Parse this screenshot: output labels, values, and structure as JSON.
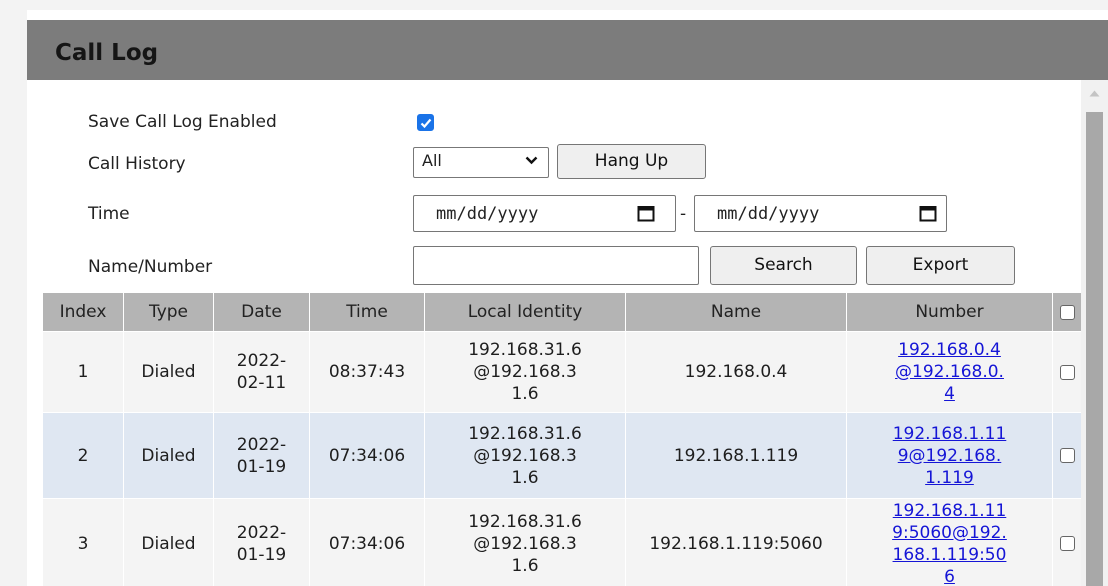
{
  "page": {
    "title": "Call Log"
  },
  "settings": {
    "save_call_log_label": "Save Call Log Enabled",
    "save_call_log_enabled": true,
    "call_history_label": "Call History",
    "call_history_value": "All",
    "hang_up_label": "Hang Up",
    "time_label": "Time",
    "date_from_placeholder": "mm/dd/yyyy",
    "date_separator": "-",
    "date_to_placeholder": "mm/dd/yyyy",
    "name_number_label": "Name/Number",
    "name_number_value": "",
    "search_label": "Search",
    "export_label": "Export"
  },
  "table": {
    "columns": [
      "Index",
      "Type",
      "Date",
      "Time",
      "Local Identity",
      "Name",
      "Number"
    ],
    "rows": [
      {
        "index": "1",
        "type": "Dialed",
        "date": "2022-02-11",
        "time": "08:37:43",
        "local_identity": "192.168.31.6@192.168.31.6",
        "name": "192.168.0.4",
        "number": "192.168.0.4@192.168.0.4"
      },
      {
        "index": "2",
        "type": "Dialed",
        "date": "2022-01-19",
        "time": "07:34:06",
        "local_identity": "192.168.31.6@192.168.31.6",
        "name": "192.168.1.119",
        "number": "192.168.1.119@192.168.1.119"
      },
      {
        "index": "3",
        "type": "Dialed",
        "date": "2022-01-19",
        "time": "07:34:06",
        "local_identity": "192.168.31.6@192.168.31.6",
        "name": "192.168.1.119:5060",
        "number": "192.168.1.119:5060@192.168.1.119:506"
      }
    ]
  },
  "colors": {
    "title_bar": "#7c7c7c",
    "header_row": "#b4b4b4",
    "row_odd": "#f4f4f4",
    "row_even": "#dfe7f2",
    "link": "#1515d6",
    "checkbox_accent": "#1a73e8"
  },
  "icons": {
    "checkbox": "checkmark-icon",
    "select": "chevron-down-icon",
    "date": "calendar-icon",
    "scroll": "scroll-up-arrow-icon"
  }
}
